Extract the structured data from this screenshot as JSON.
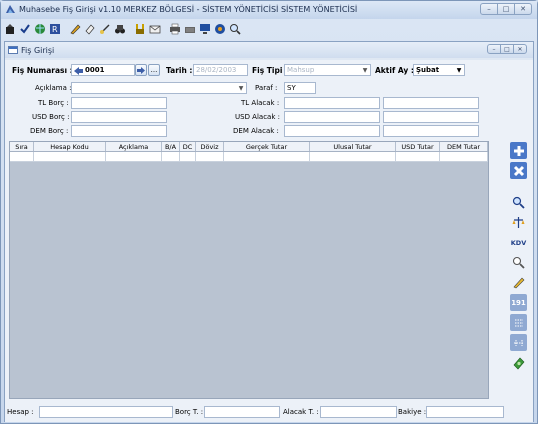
{
  "app": {
    "title": "Muhasebe Fiş Girişi v1.10 MERKEZ BÖLGESİ - SİSTEM YÖNETİCİSİ SİSTEM YÖNETİCİSİ",
    "window_controls": [
      "–",
      "□",
      "✕"
    ]
  },
  "toolbar": {
    "icons": [
      "exit-icon",
      "check-icon",
      "globe-icon",
      "report-icon",
      "pen-icon",
      "eraser-icon",
      "edit-icon",
      "search-binoculars-icon",
      "tools-icon",
      "mail-icon",
      "print-icon",
      "keyboard-icon",
      "monitor-icon",
      "network-icon",
      "zoom-icon"
    ]
  },
  "child": {
    "title": "Fiş Girişi",
    "window_controls": [
      "–",
      "□",
      "✕"
    ]
  },
  "form": {
    "fis_numarasi_label": "Fiş Numarası :",
    "fis_numarasi_value": "0001",
    "tarih_label": "Tarih :",
    "tarih_value": "28/02/2003",
    "fis_tipi_label": "Fiş Tipi :",
    "fis_tipi_value": "Mahsup",
    "aktif_ay_label": "Aktif Ay :",
    "aktif_ay_value": "Şubat",
    "aciklama_label": "Açıklama :",
    "aciklama_value": "",
    "paraf_label": "Paraf :",
    "paraf_value": "SY",
    "tl_borc_label": "TL Borç :",
    "usd_borc_label": "USD Borç :",
    "dem_borc_label": "DEM Borç :",
    "tl_alacak_label": "TL Alacak :",
    "usd_alacak_label": "USD Alacak :",
    "dem_alacak_label": "DEM Alacak :",
    "ellipsis": "..."
  },
  "grid": {
    "columns": [
      "Sıra",
      "Hesap Kodu",
      "Açıklama",
      "B/A",
      "DC",
      "Döviz",
      "Gerçek Tutar",
      "Ulusal Tutar",
      "USD Tutar",
      "DEM Tutar"
    ]
  },
  "side_tools": {
    "icons": [
      "add-icon",
      "delete-icon",
      "search-icon",
      "balance-icon",
      "kdv-icon",
      "zoom-icon",
      "pen-icon",
      "calendar-191-icon",
      "list-icon",
      "grid-icon",
      "money-icon"
    ],
    "kdv_label": "KDV",
    "num_label": "191"
  },
  "footer": {
    "hesap_label": "Hesap :",
    "borc_t_label": "Borç T. :",
    "alacak_t_label": "Alacak T. :",
    "bakiye_label": "Bakiye :"
  }
}
